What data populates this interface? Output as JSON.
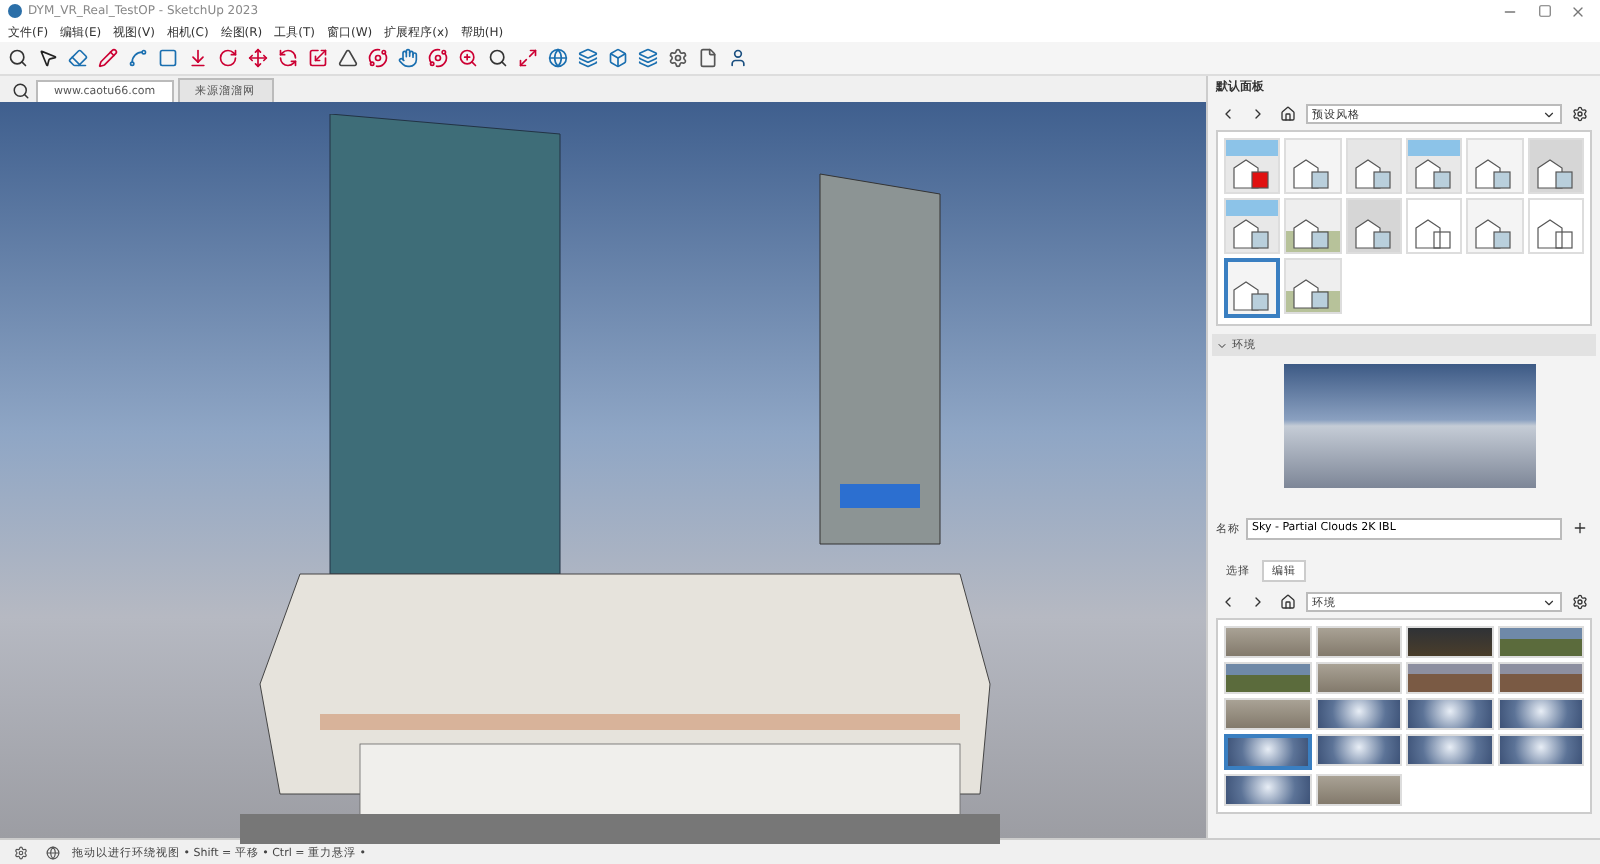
{
  "window": {
    "title": "DYM_VR_Real_TestOP - SketchUp 2023"
  },
  "menu": [
    "文件(F)",
    "编辑(E)",
    "视图(V)",
    "相机(C)",
    "绘图(R)",
    "工具(T)",
    "窗口(W)",
    "扩展程序(x)",
    "帮助(H)"
  ],
  "scene_tabs": [
    {
      "label": "www.caotu66.com",
      "selected": true
    },
    {
      "label": "来源溜溜网",
      "selected": false
    }
  ],
  "panel": {
    "title": "默认面板",
    "styles": {
      "dropdown": "预设风格",
      "thumbnails": [
        {
          "kind": "sky",
          "selected": false,
          "accent": true
        },
        {
          "kind": "plain",
          "selected": false,
          "accent": false
        },
        {
          "kind": "xray",
          "selected": false,
          "accent": false
        },
        {
          "kind": "sky",
          "selected": false,
          "accent": false
        },
        {
          "kind": "plain",
          "selected": false,
          "accent": false
        },
        {
          "kind": "grey",
          "selected": false,
          "accent": false
        },
        {
          "kind": "sky",
          "selected": false,
          "accent": false
        },
        {
          "kind": "green",
          "selected": false,
          "accent": false
        },
        {
          "kind": "grey",
          "selected": false,
          "accent": false
        },
        {
          "kind": "wire",
          "selected": false,
          "accent": false
        },
        {
          "kind": "plain",
          "selected": false,
          "accent": false
        },
        {
          "kind": "wire",
          "selected": false,
          "accent": false
        },
        {
          "kind": "plain",
          "selected": true,
          "accent": false
        },
        {
          "kind": "green",
          "selected": false,
          "accent": false
        }
      ]
    },
    "environment": {
      "title": "环境",
      "expanded": true,
      "name_label": "名称",
      "name_value": "Sky - Partial Clouds 2K IBL",
      "tabs": [
        {
          "label": "选择",
          "selected": false
        },
        {
          "label": "编辑",
          "selected": true
        }
      ],
      "dropdown": "环境",
      "thumbnails": [
        {
          "kind": "field",
          "selected": false
        },
        {
          "kind": "field",
          "selected": false
        },
        {
          "kind": "dark",
          "selected": false
        },
        {
          "kind": "grass",
          "selected": false
        },
        {
          "kind": "grass",
          "selected": false
        },
        {
          "kind": "field",
          "selected": false
        },
        {
          "kind": "brown",
          "selected": false
        },
        {
          "kind": "brown",
          "selected": false
        },
        {
          "kind": "field",
          "selected": false
        },
        {
          "kind": "sky",
          "selected": false
        },
        {
          "kind": "sky",
          "selected": false
        },
        {
          "kind": "sky",
          "selected": false
        },
        {
          "kind": "sky",
          "selected": true
        },
        {
          "kind": "sky",
          "selected": false
        },
        {
          "kind": "sky",
          "selected": false
        },
        {
          "kind": "sky",
          "selected": false
        },
        {
          "kind": "sky",
          "selected": false
        },
        {
          "kind": "field",
          "selected": false
        }
      ]
    }
  },
  "status_bar": {
    "hint": "拖动以进行环绕视图 • Shift = 平移 • Ctrl = 重力悬浮 •"
  }
}
